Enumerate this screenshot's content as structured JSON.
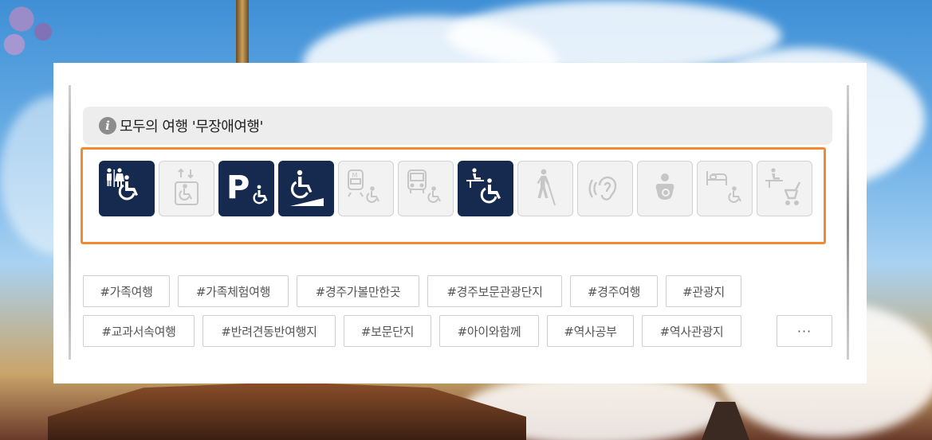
{
  "section": {
    "info_icon": "i",
    "title": "모두의 여행 '무장애여행'"
  },
  "facilities": [
    {
      "name": "accessible-restroom",
      "active": true
    },
    {
      "name": "accessible-elevator",
      "active": false
    },
    {
      "name": "accessible-parking",
      "active": true
    },
    {
      "name": "accessible-ramp",
      "active": true
    },
    {
      "name": "subway-access",
      "active": false
    },
    {
      "name": "bus-access",
      "active": false
    },
    {
      "name": "wheelchair-rental",
      "active": true
    },
    {
      "name": "visual-impairment",
      "active": false
    },
    {
      "name": "hearing-impairment",
      "active": false
    },
    {
      "name": "nursing-room",
      "active": false
    },
    {
      "name": "accessible-lodging",
      "active": false
    },
    {
      "name": "stroller-rental",
      "active": false
    }
  ],
  "tags": [
    "#가족여행",
    "#가족체험여행",
    "#경주가볼만한곳",
    "#경주보문관광단지",
    "#경주여행",
    "#관광지",
    "#교과서속여행",
    "#반려견동반여행지",
    "#보문단지",
    "#아이와함께",
    "#역사공부",
    "#역사관광지"
  ],
  "more_label": "···",
  "colors": {
    "active_icon_bg": "#152a4e",
    "inactive_icon_bg": "#f2f2f2",
    "highlight_border": "#f28a30",
    "header_bg": "#ededed"
  }
}
